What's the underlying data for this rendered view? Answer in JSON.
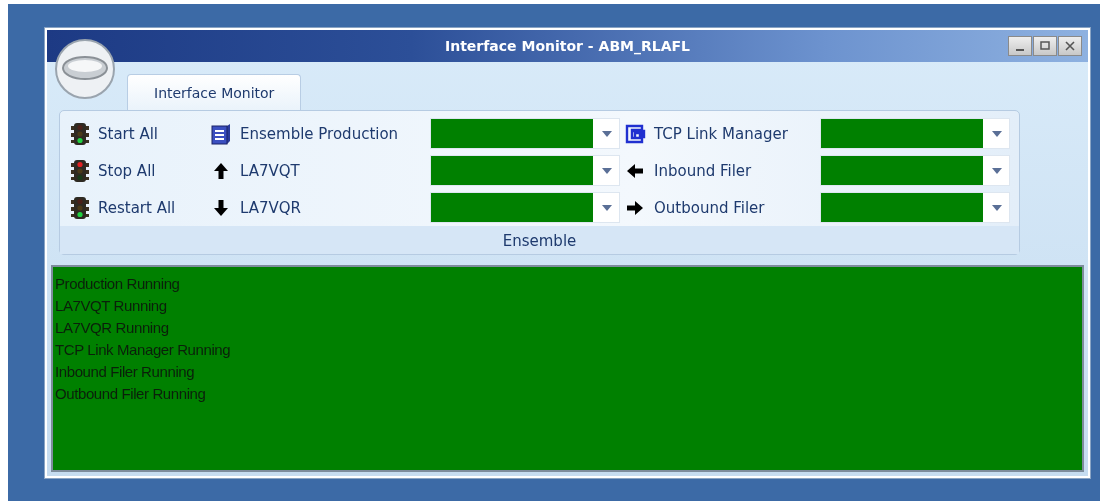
{
  "window": {
    "title": "Interface Monitor - ABM_RLAFL"
  },
  "tabs": [
    {
      "label": "Interface Monitor",
      "selected": true
    }
  ],
  "commands": [
    {
      "label": "Start All",
      "color": "#20d040"
    },
    {
      "label": "Stop All",
      "color": "#e02020"
    },
    {
      "label": "Restart All",
      "color": "#20d040"
    }
  ],
  "components": [
    {
      "label": "Ensemble Production",
      "kind": "production",
      "color": "#008000"
    },
    {
      "label": "LA7VQT",
      "kind": "up",
      "color": "#008000"
    },
    {
      "label": "LA7VQR",
      "kind": "down",
      "color": "#008000"
    },
    {
      "label": "TCP Link Manager",
      "kind": "link",
      "color": "#008000"
    },
    {
      "label": "Inbound Filer",
      "kind": "left",
      "color": "#008000"
    },
    {
      "label": "Outbound Filer",
      "kind": "right",
      "color": "#008000"
    }
  ],
  "group_label": "Ensemble",
  "log": {
    "lines": [
      "Production Running",
      "LA7VQT Running",
      "LA7VQR Running",
      "TCP Link Manager Running",
      "Inbound Filer Running",
      "Outbound Filer Running"
    ]
  }
}
